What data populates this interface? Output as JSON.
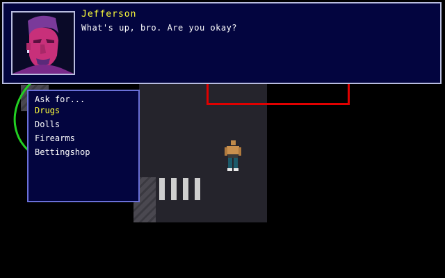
{
  "dialog": {
    "speaker": "Jefferson",
    "text": "What's up, bro. Are you okay?",
    "portrait": "jefferson-portrait"
  },
  "menu": {
    "title": "Ask for...",
    "items": [
      "Drugs",
      "Dolls",
      "Firearms",
      "Bettingshop"
    ],
    "selected_index": 0
  },
  "colors": {
    "dialog_bg": "#03053f",
    "speaker": "#ffff3a",
    "selected": "#ffff3a",
    "zone_marker": "#e00000",
    "range_arc": "#22d022"
  }
}
